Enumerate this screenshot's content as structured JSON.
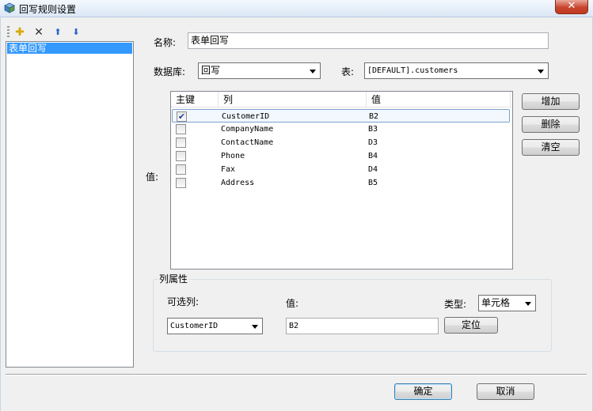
{
  "window": {
    "title": "回写规则设置",
    "close_glyph": "✕"
  },
  "toolbar": {
    "items": [
      {
        "name": "new-rule-icon",
        "glyph": "✚"
      },
      {
        "name": "delete-icon",
        "glyph": "✕"
      },
      {
        "name": "move-up-icon",
        "glyph": "⬆"
      },
      {
        "name": "move-down-icon",
        "glyph": "⬇"
      }
    ]
  },
  "rules": {
    "items": [
      "表单回写"
    ],
    "selected_index": 0
  },
  "form": {
    "name_label": "名称:",
    "name_value": "表单回写",
    "database_label": "数据库:",
    "database_value": "回写",
    "table_label": "表:",
    "table_value": "[DEFAULT].customers",
    "values_label": "值:"
  },
  "grid": {
    "columns": [
      "主键",
      "列",
      "值"
    ],
    "rows": [
      {
        "key": true,
        "column": "CustomerID",
        "value": "B2"
      },
      {
        "key": false,
        "column": "CompanyName",
        "value": "B3"
      },
      {
        "key": false,
        "column": "ContactName",
        "value": "D3"
      },
      {
        "key": false,
        "column": "Phone",
        "value": "B4"
      },
      {
        "key": false,
        "column": "Fax",
        "value": "D4"
      },
      {
        "key": false,
        "column": "Address",
        "value": "B5"
      }
    ],
    "selected_index": 0
  },
  "side_buttons": {
    "add": "增加",
    "delete": "删除",
    "clear": "清空"
  },
  "column_props": {
    "title": "列属性",
    "optional_label": "可选列:",
    "optional_value": "CustomerID",
    "value_label": "值:",
    "value_value": "B2",
    "type_label": "类型:",
    "type_value": "单元格",
    "locate_button": "定位"
  },
  "footer": {
    "ok": "确定",
    "cancel": "取消"
  },
  "colors": {
    "selection": "#3399ff",
    "titlebar": "#dbe7f5",
    "close": "#c8452e"
  }
}
